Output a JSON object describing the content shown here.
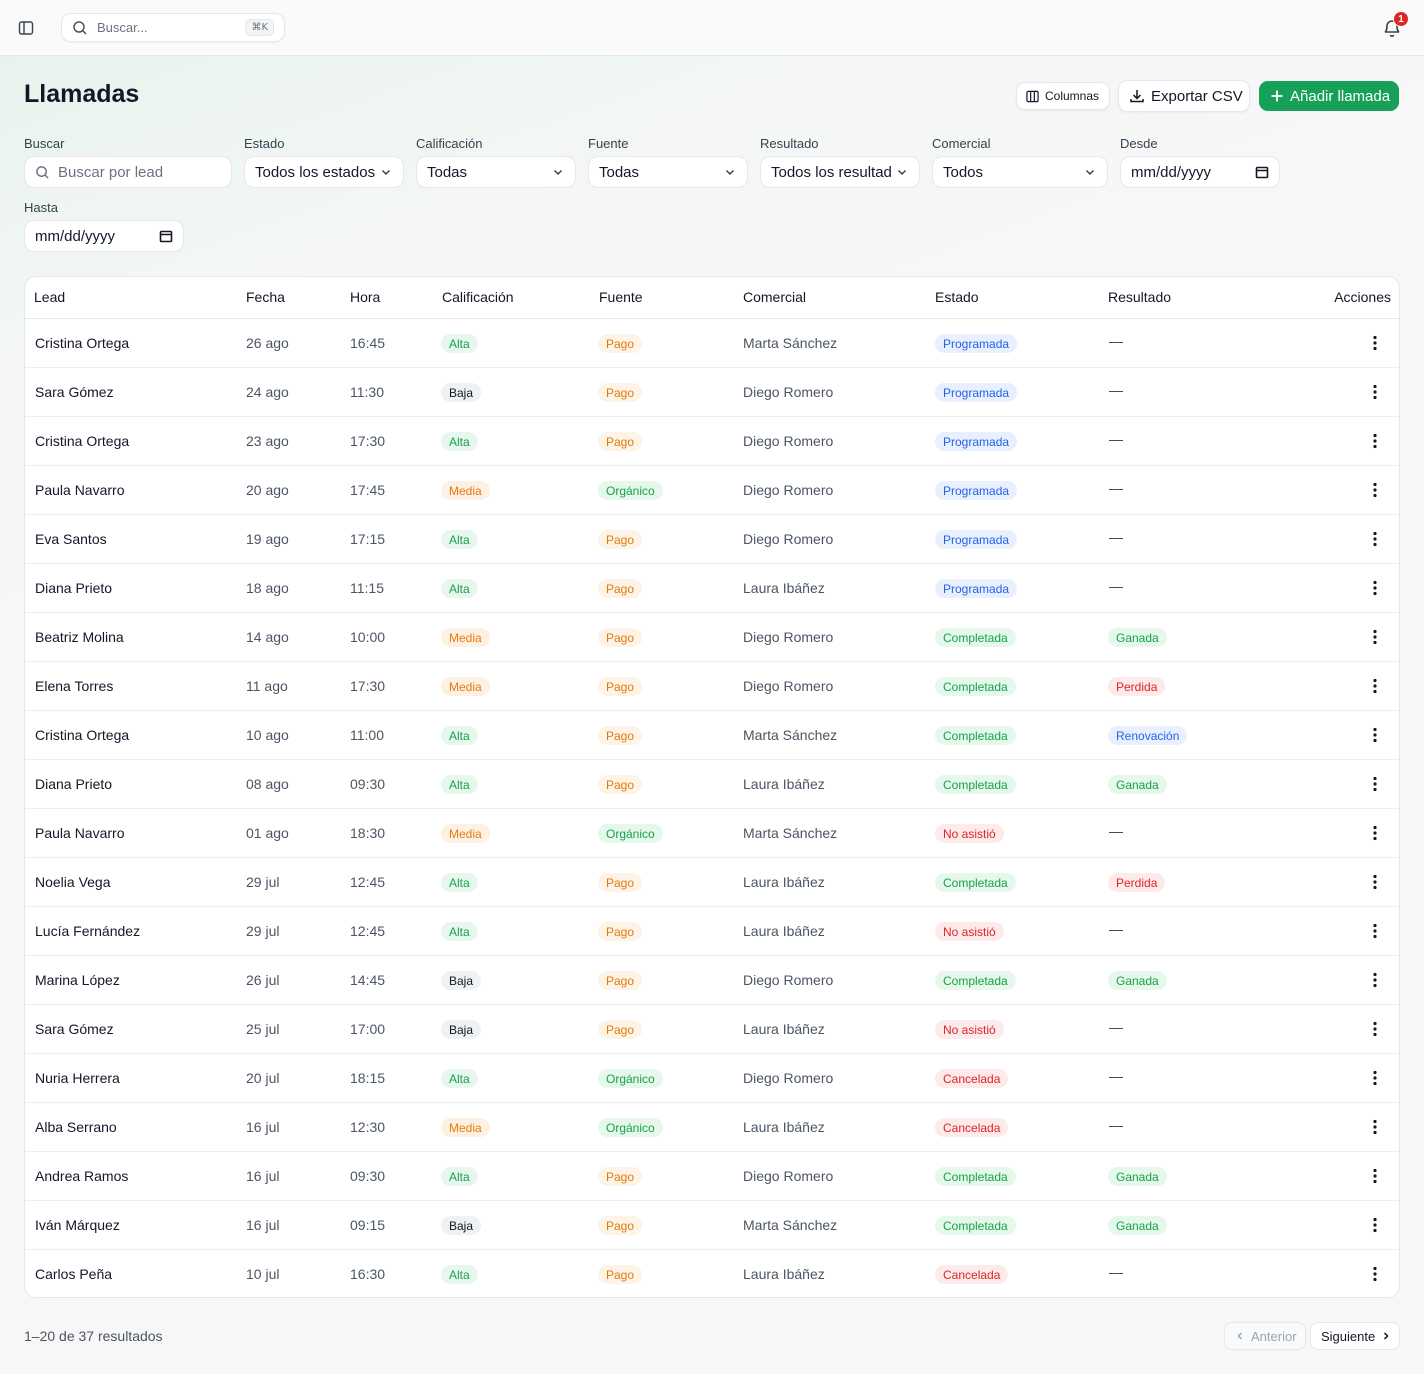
{
  "topbar": {
    "search_placeholder": "Buscar...",
    "search_shortcut": "⌘K",
    "notification_count": "1"
  },
  "page": {
    "title": "Llamadas"
  },
  "actions": {
    "columns_label": "Columnas",
    "export_label": "Exportar CSV",
    "add_label": "Añadir llamada"
  },
  "filters": {
    "search": {
      "label": "Buscar",
      "placeholder": "Buscar por lead"
    },
    "estado": {
      "label": "Estado",
      "value": "Todos los estados"
    },
    "calificacion": {
      "label": "Calificación",
      "value": "Todas"
    },
    "fuente": {
      "label": "Fuente",
      "value": "Todas"
    },
    "resultado": {
      "label": "Resultado",
      "value": "Todos los resultados"
    },
    "comercial": {
      "label": "Comercial",
      "value": "Todos"
    },
    "desde": {
      "label": "Desde",
      "value": "mm/dd/yyyy"
    },
    "hasta": {
      "label": "Hasta",
      "value": "mm/dd/yyyy"
    }
  },
  "table": {
    "headers": {
      "lead": "Lead",
      "fecha": "Fecha",
      "hora": "Hora",
      "calificacion": "Calificación",
      "fuente": "Fuente",
      "comercial": "Comercial",
      "estado": "Estado",
      "resultado": "Resultado",
      "acciones": "Acciones"
    },
    "rows": [
      {
        "lead": "Cristina Ortega",
        "fecha": "26 ago",
        "hora": "16:45",
        "calificacion": "Alta",
        "fuente": "Pago",
        "comercial": "Marta Sánchez",
        "estado": "Programada",
        "resultado": "—"
      },
      {
        "lead": "Sara Gómez",
        "fecha": "24 ago",
        "hora": "11:30",
        "calificacion": "Baja",
        "fuente": "Pago",
        "comercial": "Diego Romero",
        "estado": "Programada",
        "resultado": "—"
      },
      {
        "lead": "Cristina Ortega",
        "fecha": "23 ago",
        "hora": "17:30",
        "calificacion": "Alta",
        "fuente": "Pago",
        "comercial": "Diego Romero",
        "estado": "Programada",
        "resultado": "—"
      },
      {
        "lead": "Paula Navarro",
        "fecha": "20 ago",
        "hora": "17:45",
        "calificacion": "Media",
        "fuente": "Orgánico",
        "comercial": "Diego Romero",
        "estado": "Programada",
        "resultado": "—"
      },
      {
        "lead": "Eva Santos",
        "fecha": "19 ago",
        "hora": "17:15",
        "calificacion": "Alta",
        "fuente": "Pago",
        "comercial": "Diego Romero",
        "estado": "Programada",
        "resultado": "—"
      },
      {
        "lead": "Diana Prieto",
        "fecha": "18 ago",
        "hora": "11:15",
        "calificacion": "Alta",
        "fuente": "Pago",
        "comercial": "Laura Ibáñez",
        "estado": "Programada",
        "resultado": "—"
      },
      {
        "lead": "Beatriz Molina",
        "fecha": "14 ago",
        "hora": "10:00",
        "calificacion": "Media",
        "fuente": "Pago",
        "comercial": "Diego Romero",
        "estado": "Completada",
        "resultado": "Ganada"
      },
      {
        "lead": "Elena Torres",
        "fecha": "11 ago",
        "hora": "17:30",
        "calificacion": "Media",
        "fuente": "Pago",
        "comercial": "Diego Romero",
        "estado": "Completada",
        "resultado": "Perdida"
      },
      {
        "lead": "Cristina Ortega",
        "fecha": "10 ago",
        "hora": "11:00",
        "calificacion": "Alta",
        "fuente": "Pago",
        "comercial": "Marta Sánchez",
        "estado": "Completada",
        "resultado": "Renovación"
      },
      {
        "lead": "Diana Prieto",
        "fecha": "08 ago",
        "hora": "09:30",
        "calificacion": "Alta",
        "fuente": "Pago",
        "comercial": "Laura Ibáñez",
        "estado": "Completada",
        "resultado": "Ganada"
      },
      {
        "lead": "Paula Navarro",
        "fecha": "01 ago",
        "hora": "18:30",
        "calificacion": "Media",
        "fuente": "Orgánico",
        "comercial": "Marta Sánchez",
        "estado": "No asistió",
        "resultado": "—"
      },
      {
        "lead": "Noelia Vega",
        "fecha": "29 jul",
        "hora": "12:45",
        "calificacion": "Alta",
        "fuente": "Pago",
        "comercial": "Laura Ibáñez",
        "estado": "Completada",
        "resultado": "Perdida"
      },
      {
        "lead": "Lucía Fernández",
        "fecha": "29 jul",
        "hora": "12:45",
        "calificacion": "Alta",
        "fuente": "Pago",
        "comercial": "Laura Ibáñez",
        "estado": "No asistió",
        "resultado": "—"
      },
      {
        "lead": "Marina López",
        "fecha": "26 jul",
        "hora": "14:45",
        "calificacion": "Baja",
        "fuente": "Pago",
        "comercial": "Diego Romero",
        "estado": "Completada",
        "resultado": "Ganada"
      },
      {
        "lead": "Sara Gómez",
        "fecha": "25 jul",
        "hora": "17:00",
        "calificacion": "Baja",
        "fuente": "Pago",
        "comercial": "Laura Ibáñez",
        "estado": "No asistió",
        "resultado": "—"
      },
      {
        "lead": "Nuria Herrera",
        "fecha": "20 jul",
        "hora": "18:15",
        "calificacion": "Alta",
        "fuente": "Orgánico",
        "comercial": "Diego Romero",
        "estado": "Cancelada",
        "resultado": "—"
      },
      {
        "lead": "Alba Serrano",
        "fecha": "16 jul",
        "hora": "12:30",
        "calificacion": "Media",
        "fuente": "Orgánico",
        "comercial": "Laura Ibáñez",
        "estado": "Cancelada",
        "resultado": "—"
      },
      {
        "lead": "Andrea Ramos",
        "fecha": "16 jul",
        "hora": "09:30",
        "calificacion": "Alta",
        "fuente": "Pago",
        "comercial": "Diego Romero",
        "estado": "Completada",
        "resultado": "Ganada"
      },
      {
        "lead": "Iván Márquez",
        "fecha": "16 jul",
        "hora": "09:15",
        "calificacion": "Baja",
        "fuente": "Pago",
        "comercial": "Marta Sánchez",
        "estado": "Completada",
        "resultado": "Ganada"
      },
      {
        "lead": "Carlos Peña",
        "fecha": "10 jul",
        "hora": "16:30",
        "calificacion": "Alta",
        "fuente": "Pago",
        "comercial": "Laura Ibáñez",
        "estado": "Cancelada",
        "resultado": "—"
      }
    ]
  },
  "pagination": {
    "summary": "1–20 de 37 resultados",
    "prev_label": "Anterior",
    "next_label": "Siguiente"
  },
  "colors": {
    "primary": "#16a058",
    "badge_red": "#dc2626"
  }
}
